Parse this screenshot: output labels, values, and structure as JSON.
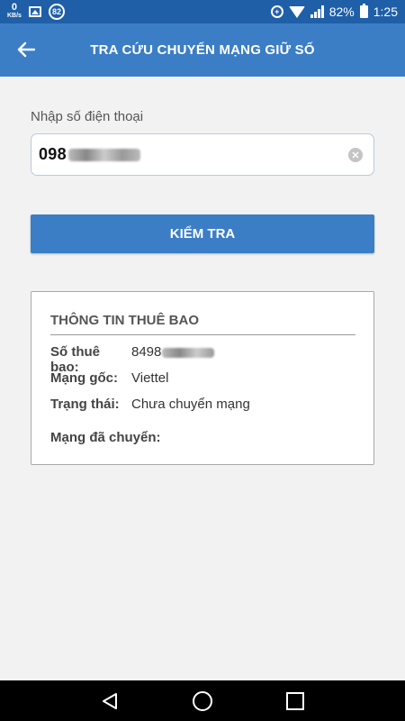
{
  "status_bar": {
    "speed_value": "0",
    "speed_unit": "KB/s",
    "badge_count": "82",
    "battery_percent": "82%",
    "time": "1:25",
    "icons": [
      "image-icon",
      "sync-icon",
      "wifi-icon",
      "signal-icon",
      "battery-icon"
    ]
  },
  "app_bar": {
    "title": "TRA CỨU CHUYỂN MẠNG GIỮ SỐ",
    "back_icon": "arrow-left-icon"
  },
  "form": {
    "label": "Nhập số điện thoại",
    "phone_value_visible": "098",
    "clear_icon": "clear-icon",
    "check_button_label": "KIỂM TRA"
  },
  "subscriber_info": {
    "title": "THÔNG TIN THUÊ BAO",
    "rows": [
      {
        "label": "Số thuê bao:",
        "value": "8498"
      },
      {
        "label": "Mạng gốc:",
        "value": "Viettel"
      },
      {
        "label": "Trạng thái:",
        "value": "Chưa chuyển mạng"
      },
      {
        "label": "Mạng đã chuyển:",
        "value": ""
      }
    ]
  },
  "nav_bar": {
    "icons": [
      "back-triangle-icon",
      "home-circle-icon",
      "recents-square-icon"
    ]
  },
  "colors": {
    "status_bar": "#1f5fa8",
    "app_bar": "#3b7ec6",
    "button": "#3b7ec6",
    "background": "#f2f2f2"
  }
}
